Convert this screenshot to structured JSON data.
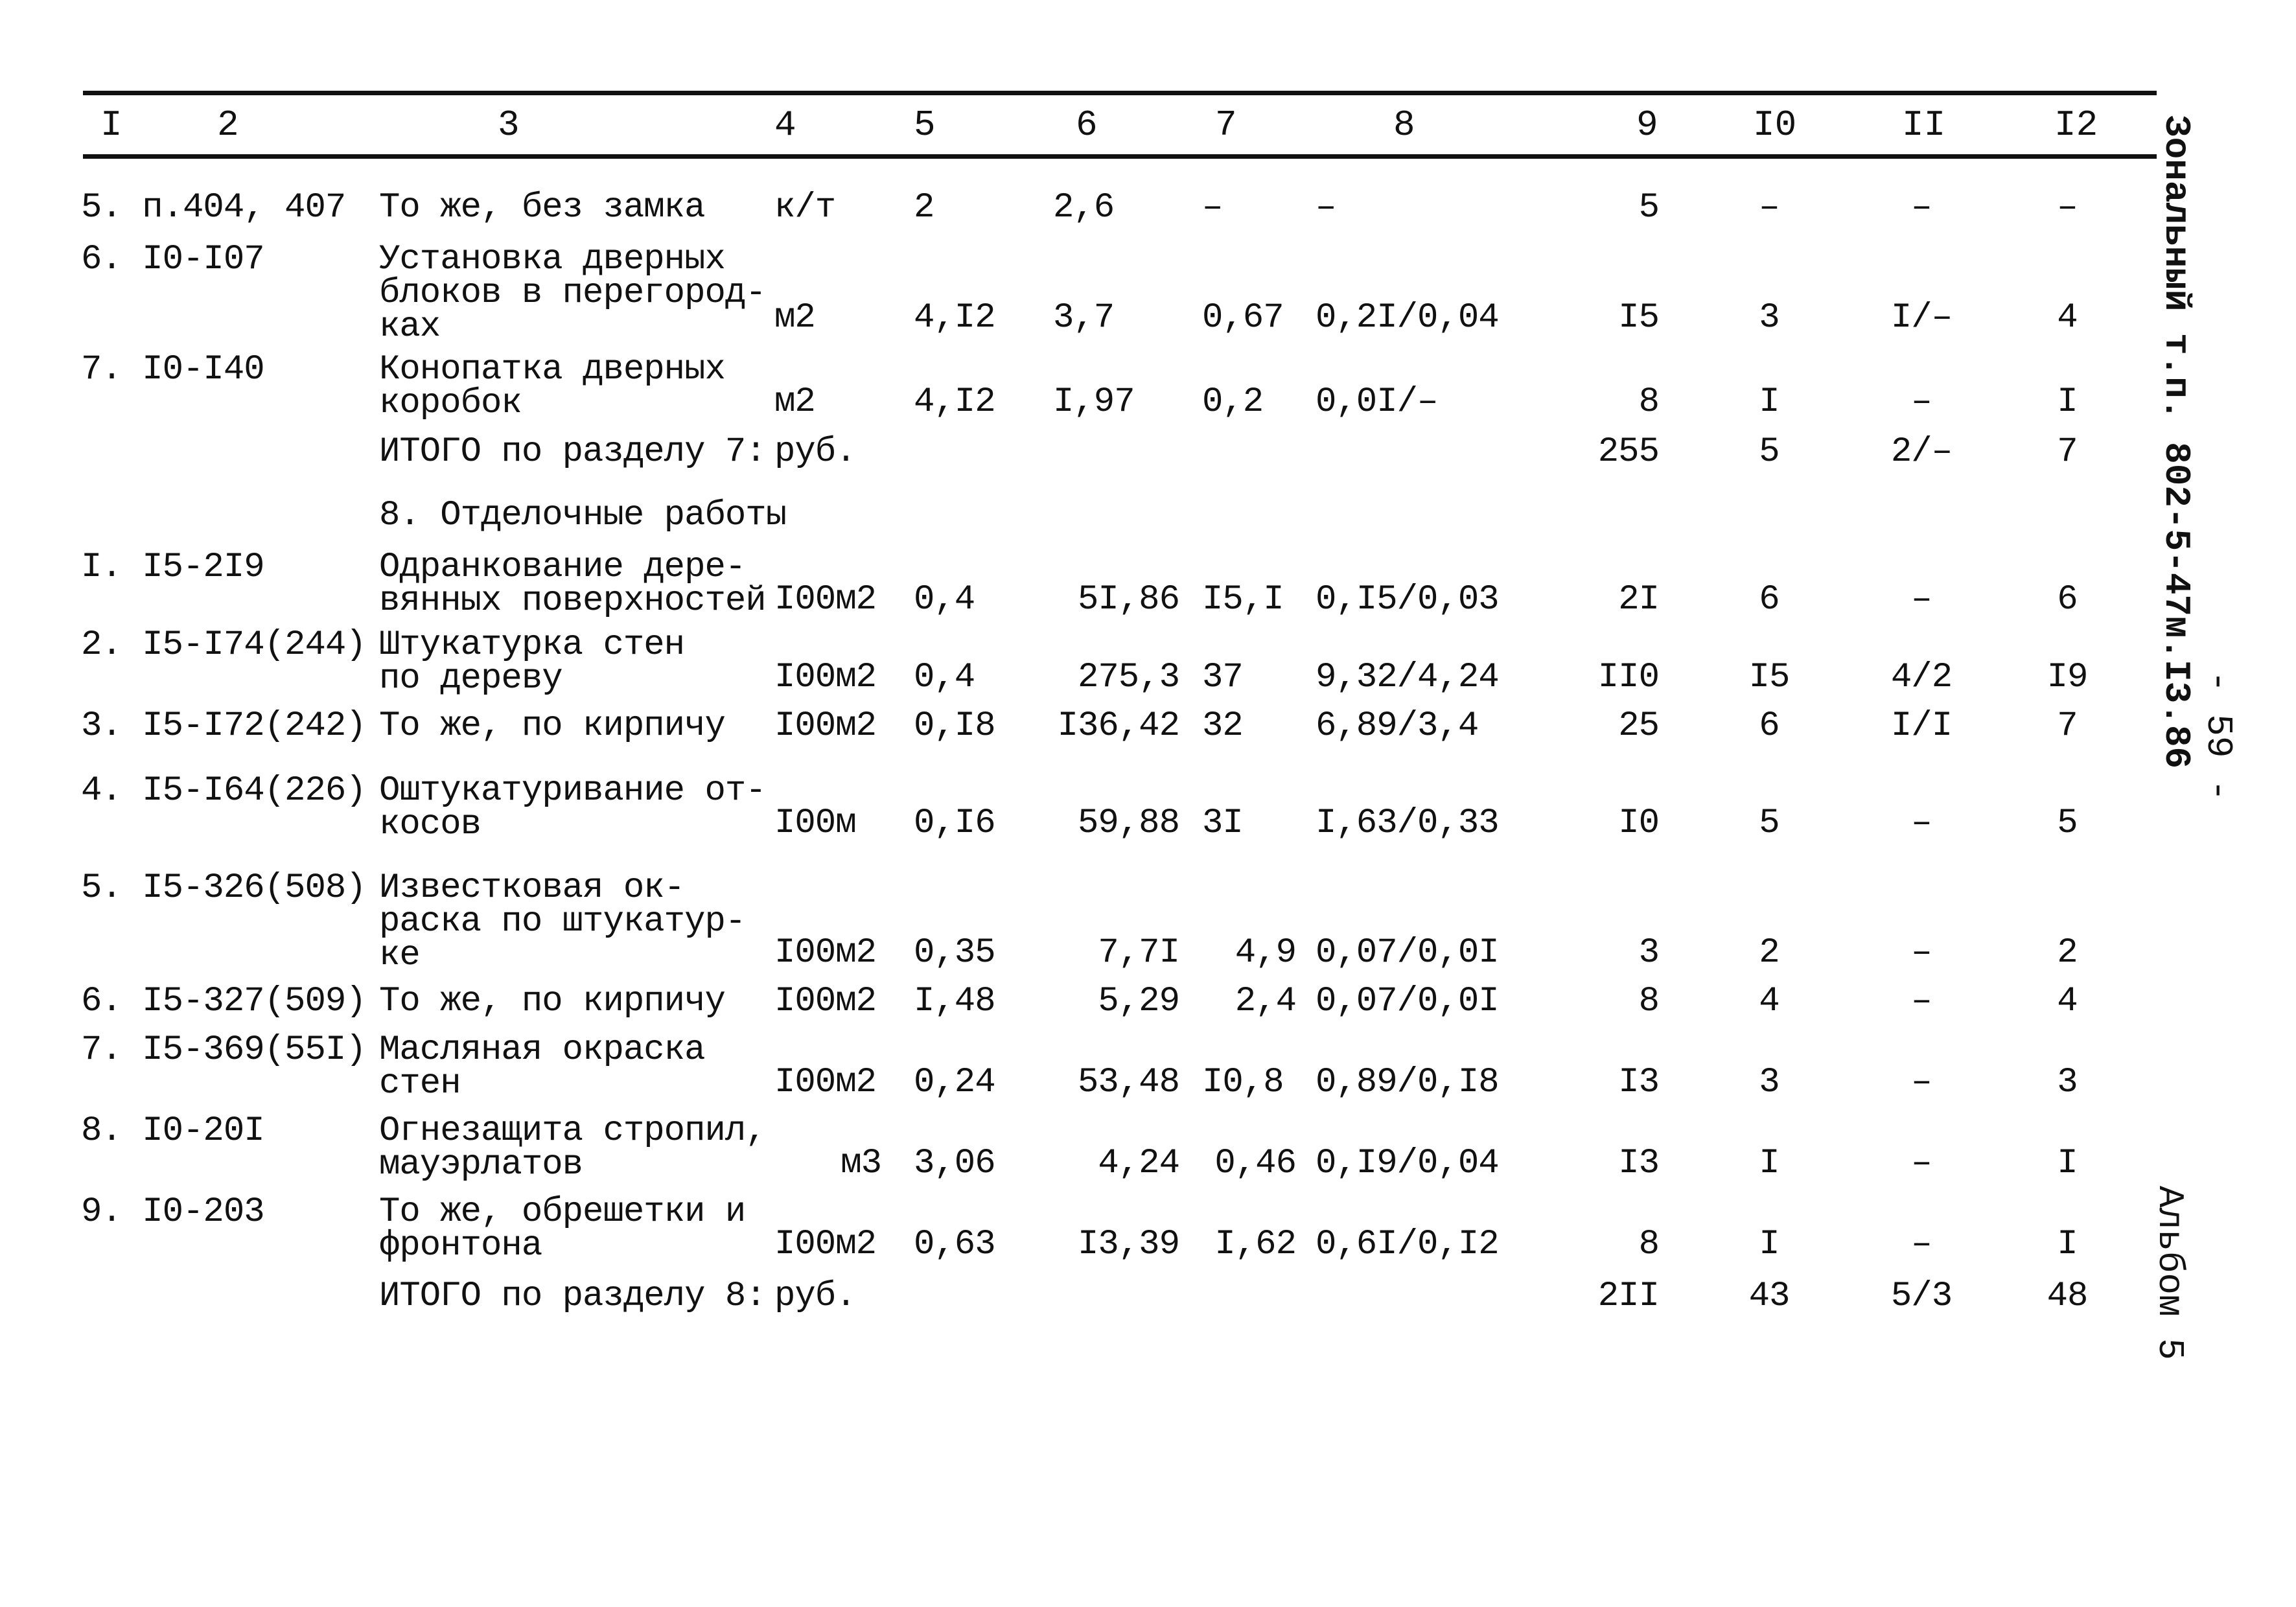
{
  "header": {
    "columns": [
      "I",
      "2",
      "3",
      "4",
      "5",
      "6",
      "7",
      "8",
      "9",
      "I0",
      "II",
      "I2"
    ]
  },
  "side": {
    "doc_code": "Зональный т.п. 802-5-47м.I3.86",
    "page_number": "- 59 -",
    "album": "Альбом 5"
  },
  "section8_title": "8. Отделочные работы",
  "rows": [
    {
      "n": "5. п.404, 407",
      "desc": "То же, без замка",
      "unit": "к/т",
      "c5": "2",
      "c6": "2,6",
      "c7": "–",
      "c8": "–",
      "c9": "5",
      "c10": "–",
      "c11": "–",
      "c12": "–"
    },
    {
      "n": "6. I0-I07",
      "desc": "Установка дверных\nблоков в перегород-\nках",
      "unit": "м2",
      "c5": "4,I2",
      "c6": "3,7",
      "c7": "0,67",
      "c8": "0,2I/0,04",
      "c9": "I5",
      "c10": "3",
      "c11": "I/–",
      "c12": "4"
    },
    {
      "n": "7. I0-I40",
      "desc": "Конопатка дверных\nкоробок",
      "unit": "м2",
      "c5": "4,I2",
      "c6": "I,97",
      "c7": "0,2",
      "c8": "0,0I/–",
      "c9": "8",
      "c10": "I",
      "c11": "–",
      "c12": "I"
    },
    {
      "n": "",
      "desc": "ИТОГО по разделу 7:",
      "unit": "руб.",
      "c5": "",
      "c6": "",
      "c7": "",
      "c8": "",
      "c9": "255",
      "c10": "5",
      "c11": "2/–",
      "c12": "7"
    },
    {
      "n": "I. I5-2I9",
      "desc": "Одранкование дере-\nвянных поверхностей",
      "unit": "I00м2",
      "c5": "0,4",
      "c6": "5I,86",
      "c7": "I5,I",
      "c8": "0,I5/0,03",
      "c9": "2I",
      "c10": "6",
      "c11": "–",
      "c12": "6"
    },
    {
      "n": "2. I5-I74(244)",
      "desc": "Штукатурка стен\nпо дереву",
      "unit": "I00м2",
      "c5": "0,4",
      "c6": "275,3",
      "c7": "37",
      "c8": "9,32/4,24",
      "c9": "II0",
      "c10": "I5",
      "c11": "4/2",
      "c12": "I9"
    },
    {
      "n": "3. I5-I72(242)",
      "desc": "То же, по кирпичу",
      "unit": "I00м2",
      "c5": "0,I8",
      "c6": "I36,42",
      "c7": "32",
      "c8": "6,89/3,4",
      "c9": "25",
      "c10": "6",
      "c11": "I/I",
      "c12": "7"
    },
    {
      "n": "4. I5-I64(226)",
      "desc": "Оштукатуривание от-\nкосов",
      "unit": "I00м",
      "c5": "0,I6",
      "c6": "59,88",
      "c7": "3I",
      "c8": "I,63/0,33",
      "c9": "I0",
      "c10": "5",
      "c11": "–",
      "c12": "5"
    },
    {
      "n": "5. I5-326(508)",
      "desc": "Известковая ок-\nраска по штукатур-\nке",
      "unit": "I00м2",
      "c5": "0,35",
      "c6": "7,7I",
      "c7": "4,9",
      "c8": "0,07/0,0I",
      "c9": "3",
      "c10": "2",
      "c11": "–",
      "c12": "2"
    },
    {
      "n": "6. I5-327(509)",
      "desc": "То же, по кирпичу",
      "unit": "I00м2",
      "c5": "I,48",
      "c6": "5,29",
      "c7": "2,4",
      "c8": "0,07/0,0I",
      "c9": "8",
      "c10": "4",
      "c11": "–",
      "c12": "4"
    },
    {
      "n": "7. I5-369(55I)",
      "desc": "Масляная окраска\nстен",
      "unit": "I00м2",
      "c5": "0,24",
      "c6": "53,48",
      "c7": "I0,8",
      "c8": "0,89/0,I8",
      "c9": "I3",
      "c10": "3",
      "c11": "–",
      "c12": "3"
    },
    {
      "n": "8. I0-20I",
      "desc": "Огнезащита стропил,\nмауэрлатов",
      "unit": "м3",
      "c5": "3,06",
      "c6": "4,24",
      "c7": "0,46",
      "c8": "0,I9/0,04",
      "c9": "I3",
      "c10": "I",
      "c11": "–",
      "c12": "I"
    },
    {
      "n": "9. I0-203",
      "desc": "То же, обрешетки и\nфронтона",
      "unit": "I00м2",
      "c5": "0,63",
      "c6": "I3,39",
      "c7": "I,62",
      "c8": "0,6I/0,I2",
      "c9": "8",
      "c10": "I",
      "c11": "–",
      "c12": "I"
    },
    {
      "n": "",
      "desc": "ИТОГО по разделу 8:",
      "unit": "руб.",
      "c5": "",
      "c6": "",
      "c7": "",
      "c8": "",
      "c9": "2II",
      "c10": "43",
      "c11": "5/3",
      "c12": "48"
    }
  ]
}
